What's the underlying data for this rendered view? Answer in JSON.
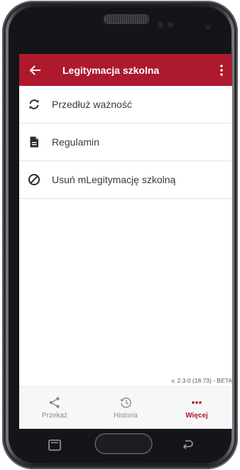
{
  "app_bar": {
    "title": "Legitymacja szkolna",
    "back_icon": "arrow-left-icon",
    "menu_icon": "more-vertical-icon"
  },
  "menu": {
    "items": [
      {
        "label": "Przedłuż ważność",
        "icon": "refresh-icon"
      },
      {
        "label": "Regulamin",
        "icon": "document-icon"
      },
      {
        "label": "Usuń mLegitymację szkolną",
        "icon": "block-icon"
      }
    ]
  },
  "version": "v. 2.3.0 (18.73) - BETA",
  "bottom_nav": {
    "items": [
      {
        "label": "Przekaż",
        "icon": "share-icon",
        "active": false
      },
      {
        "label": "Historia",
        "icon": "history-icon",
        "active": false
      },
      {
        "label": "Więcej",
        "icon": "more-horizontal-icon",
        "active": true
      }
    ]
  },
  "colors": {
    "accent": "#ad1a2e",
    "text": "#3a3a3a",
    "muted": "#8a8a8a",
    "divider": "#e4e4e4"
  }
}
